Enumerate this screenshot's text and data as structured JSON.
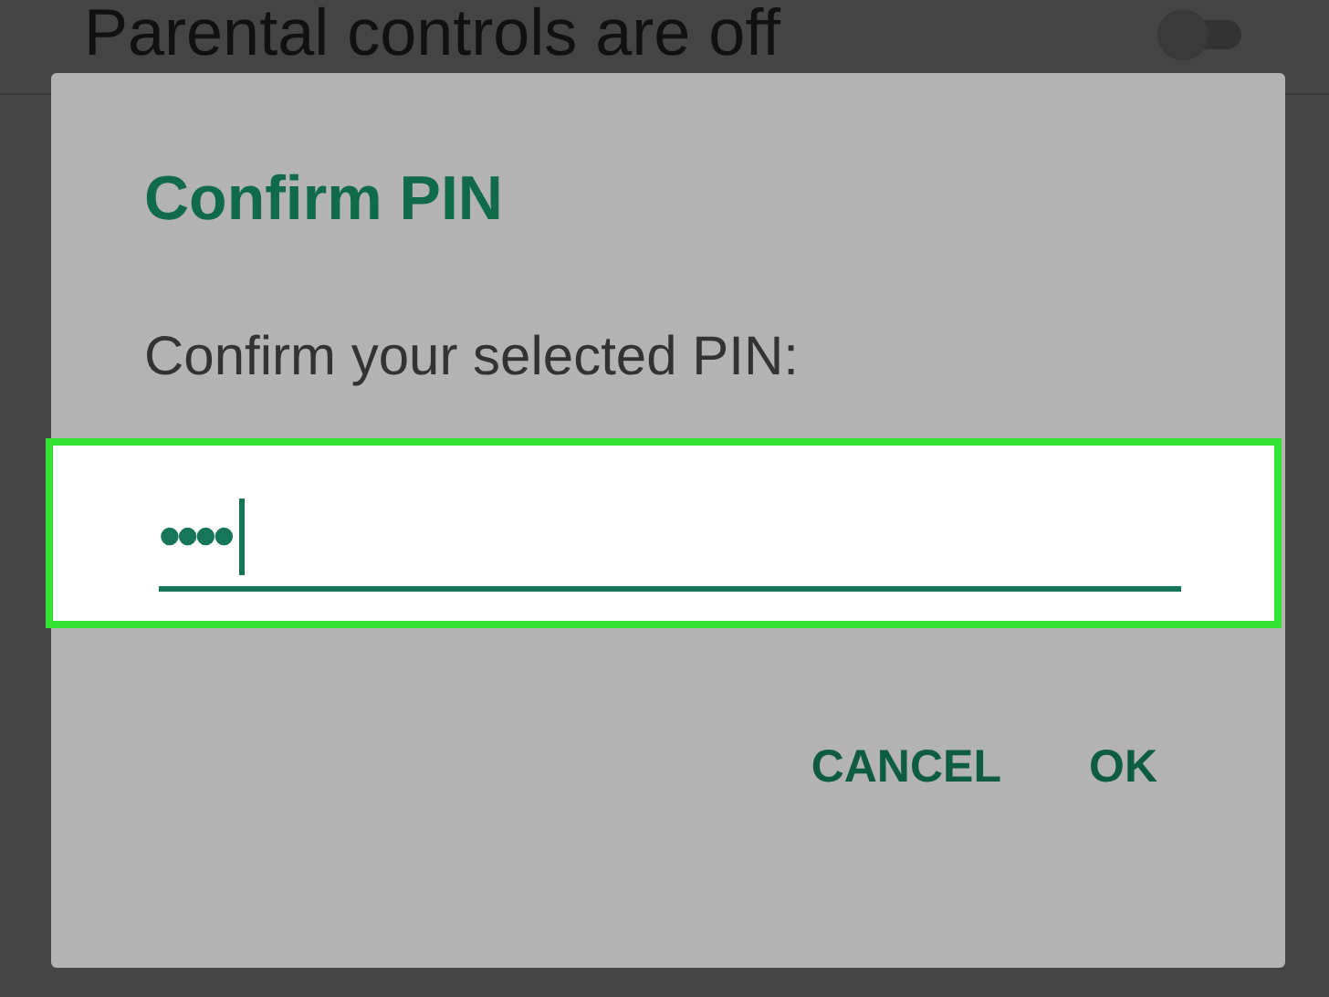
{
  "background_setting": {
    "label": "Parental controls are off",
    "on": false
  },
  "dialog": {
    "title": "Confirm PIN",
    "message": "Confirm your selected PIN:",
    "pin_field": {
      "value": "••••",
      "focused": true,
      "highlighted": true
    },
    "buttons": [
      {
        "label": "CANCEL"
      },
      {
        "label": "OK"
      }
    ]
  }
}
